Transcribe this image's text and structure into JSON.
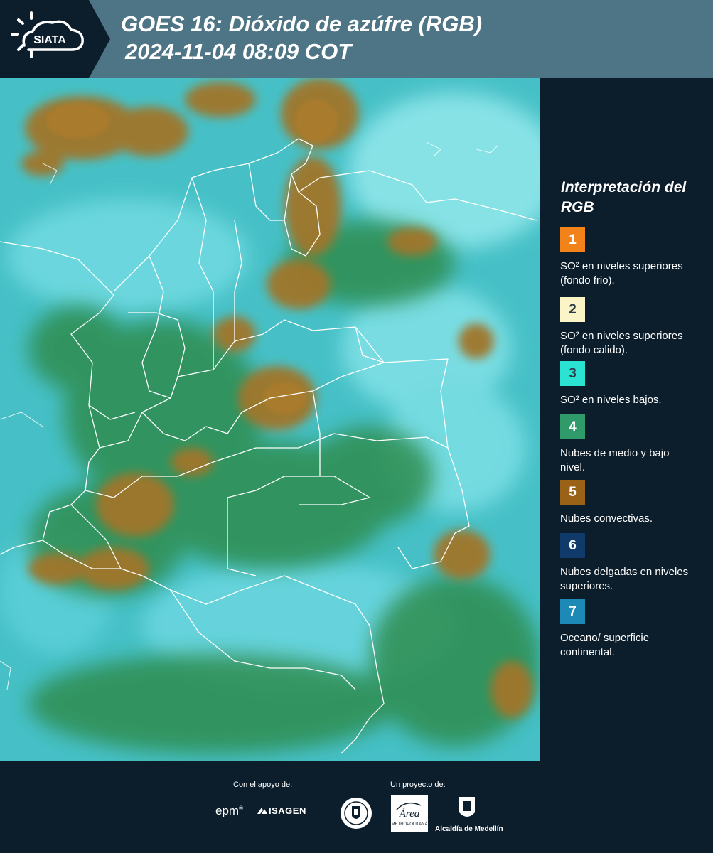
{
  "header": {
    "logo_text": "SIATA",
    "title_line1": "GOES 16: Dióxido de azúfre (RGB)",
    "title_line2": "2024-11-04 08:09 COT"
  },
  "legend": {
    "title": "Interpretación del RGB",
    "items": [
      {
        "number": "1",
        "color": "#f2821a",
        "label": "SO² en niveles superiores (fondo frio)."
      },
      {
        "number": "2",
        "color": "#fbf4c6",
        "label": "SO² en niveles superiores (fondo calido)."
      },
      {
        "number": "3",
        "color": "#2be3d2",
        "label": "SO² en niveles bajos."
      },
      {
        "number": "4",
        "color": "#2f9a6a",
        "label": "Nubes de medio y bajo nivel."
      },
      {
        "number": "5",
        "color": "#996217",
        "label": "Nubes convectivas."
      },
      {
        "number": "6",
        "color": "#0f3a6a",
        "label": "Nubes delgadas en niveles superiores."
      },
      {
        "number": "7",
        "color": "#1d89b6",
        "label": "Oceano/ superficie continental."
      }
    ]
  },
  "footer": {
    "support_caption": "Con el apoyo de:",
    "project_caption": "Un proyecto de:",
    "partner_logos": [
      "epm",
      "ISAGEN"
    ],
    "project_logos": [
      "Medellín",
      "Área Metropolitana Valle de Aburrá",
      "Alcaldía de Medellín"
    ],
    "epm_text": "epm",
    "isagen_text": "ISAGEN",
    "amva_text": "Área",
    "amva_subtext": "METROPOLITANA",
    "alcaldia_text": "Alcaldía de Medellín"
  },
  "map_colors": {
    "background": "#3fb6c2",
    "convective": "#9c7323",
    "vegetation": "#2e8a52",
    "cyan": "#3fd3dd",
    "border": "#ffffff"
  }
}
